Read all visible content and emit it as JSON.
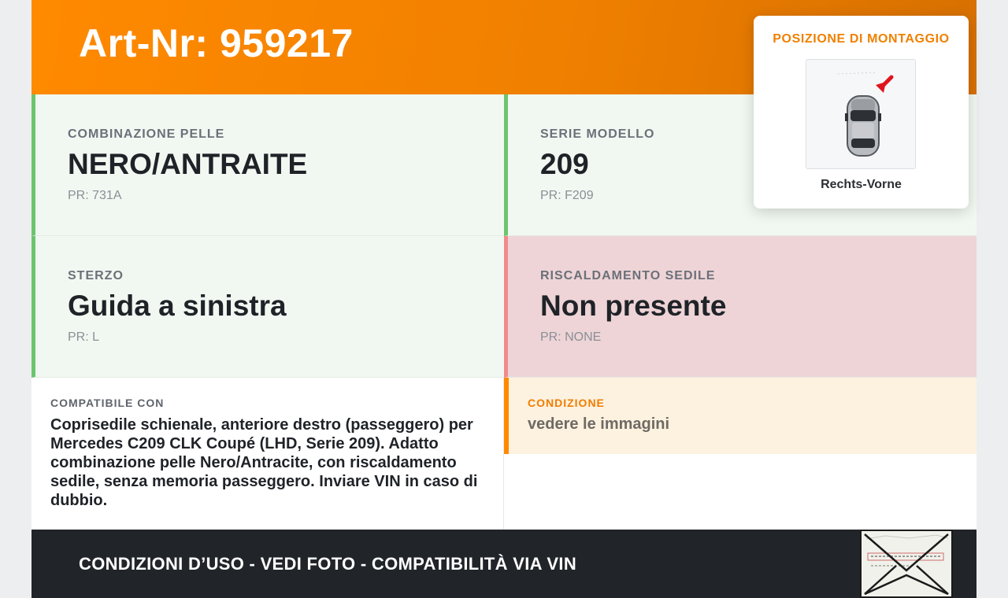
{
  "header": {
    "title": "Art-Nr: 959217"
  },
  "mounting": {
    "label": "POSIZIONE DI MONTAGGIO",
    "position": "Rechts-Vorne",
    "icon": "car-top-view-icon",
    "arrow_color": "#e0141e"
  },
  "tiles": [
    {
      "label": "COMBINAZIONE PELLE",
      "value": "NERO/ANTRAITE",
      "pr": "PR: 731A",
      "status": "ok"
    },
    {
      "label": "SERIE MODELLO",
      "value": "209",
      "pr": "PR: F209",
      "status": "ok"
    },
    {
      "label": "STERZO",
      "value": "Guida a sinistra",
      "pr": "PR: L",
      "status": "ok"
    },
    {
      "label": "RISCALDAMENTO SEDILE",
      "value": "Non presente",
      "pr": "PR: NONE",
      "status": "missing"
    }
  ],
  "compat": {
    "label": "COMPATIBILE CON",
    "text": "Coprisedile schienale, anteriore destro (passeggero) per Mercedes C209 CLK Coupé (LHD, Serie 209). Adatto combinazione pelle Nero/Antracite, con riscaldamento sedile, senza memoria passeggero. Inviare VIN in caso di dubbio."
  },
  "condition": {
    "label": "CONDIZIONE",
    "text": "vedere le immagini"
  },
  "footer": {
    "text": "CONDIZIONI D’USO - VEDI FOTO - COMPATIBILITÀ VIA VIN",
    "stamp_icon": "envelope-vin-stamp-icon"
  },
  "colors": {
    "accent": "#ff8a00",
    "ok_border": "#6cc46f",
    "ok_bg": "#f1f8f1",
    "missing_border": "#f08a8a",
    "missing_bg": "#eed4d6",
    "footer_bg": "#212529"
  }
}
